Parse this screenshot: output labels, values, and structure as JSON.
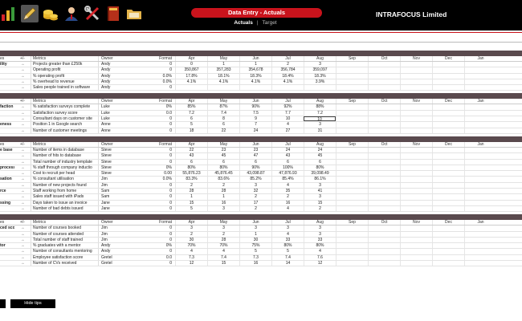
{
  "header": {
    "title": "Data Entry - Actuals",
    "tab_active": "Actuals",
    "tab_separator": "|",
    "tab_inactive": "Target",
    "company": "INTRAFOCUS Limited",
    "icons": [
      "bar-chart-icon",
      "pencil-icon",
      "coins-icon",
      "user-icon",
      "tools-icon",
      "book-icon",
      "folder-icon"
    ]
  },
  "columns": {
    "group": "es",
    "pm": "+/-",
    "metrics": "Metrics",
    "owner": "Owner",
    "format": "Format",
    "months": [
      "Apr",
      "May",
      "Jun",
      "Jul",
      "Aug",
      "Sep",
      "Oct",
      "Nov",
      "Dec",
      "Jan"
    ]
  },
  "sections": [
    {
      "header_group": "es",
      "rows": [
        {
          "group": "ility",
          "pm": "→",
          "metric": "Projects greater than £250k",
          "owner": "Andy",
          "format": "0",
          "values": [
            "0",
            "1",
            "1",
            "2",
            "3",
            "",
            "",
            "",
            "",
            ""
          ]
        },
        {
          "group": "",
          "pm": "→",
          "metric": "Operating profit",
          "owner": "Andy",
          "format": "0",
          "values": [
            "350,867",
            "357,283",
            "354,678",
            "356,784",
            "359,097",
            "",
            "",
            "",
            "",
            ""
          ]
        },
        {
          "group": "",
          "pm": "→",
          "metric": "% operating profit",
          "owner": "Andy",
          "format": "0.0%",
          "values": [
            "17.8%",
            "18.1%",
            "18.3%",
            "18.4%",
            "18.3%",
            "",
            "",
            "",
            "",
            ""
          ]
        },
        {
          "group": "",
          "pm": "→",
          "metric": "% overhead to revenue",
          "owner": "Andy",
          "format": "0.0%",
          "values": [
            "4.1%",
            "4.1%",
            "4.1%",
            "4.1%",
            "3.9%",
            "",
            "",
            "",
            "",
            ""
          ]
        },
        {
          "group": "",
          "pm": "→",
          "metric": "Sales people trained in software",
          "owner": "Andy",
          "format": "0",
          "values": [
            "",
            "",
            "",
            "",
            "",
            "",
            "",
            "",
            "",
            ""
          ]
        }
      ]
    },
    {
      "header_group": "",
      "rows": [
        {
          "group": "faction",
          "pm": "→",
          "metric": "% satisfaction surveys complete",
          "owner": "Luke",
          "format": "0%",
          "values": [
            "85%",
            "87%",
            "90%",
            "92%",
            "88%",
            "",
            "",
            "",
            "",
            ""
          ]
        },
        {
          "group": "",
          "pm": "→",
          "metric": "Satisfaction survey score",
          "owner": "Luke",
          "format": "0.0",
          "values": [
            "7.2",
            "7.4",
            "7.5",
            "7.7",
            "7.2",
            "",
            "",
            "",
            "",
            ""
          ]
        },
        {
          "group": "",
          "pm": "→",
          "metric": "Consultant days on customer site",
          "owner": "Luke",
          "format": "0",
          "values": [
            "6",
            "8",
            "9",
            "10",
            "10",
            "",
            "",
            "",
            "",
            ""
          ]
        },
        {
          "group": "eness",
          "pm": "→",
          "metric": "Position 1 in Google search",
          "owner": "Anne",
          "format": "0",
          "values": [
            "5",
            "6",
            "7",
            "4",
            "3",
            "",
            "",
            "",
            "",
            ""
          ]
        },
        {
          "group": "",
          "pm": "→",
          "metric": "Number of customer meetings",
          "owner": "Anne",
          "format": "0",
          "values": [
            "18",
            "22",
            "24",
            "27",
            "31",
            "",
            "",
            "",
            "",
            ""
          ]
        }
      ]
    },
    {
      "header_group": "es",
      "rows": [
        {
          "group": "e base",
          "pm": "→",
          "metric": "Number of items in database",
          "owner": "Steve",
          "format": "0",
          "values": [
            "22",
            "23",
            "23",
            "24",
            "24",
            "",
            "",
            "",
            "",
            ""
          ]
        },
        {
          "group": "",
          "pm": "→",
          "metric": "Number of hits to database",
          "owner": "Steve",
          "format": "0",
          "values": [
            "43",
            "45",
            "47",
            "43",
            "45",
            "",
            "",
            "",
            "",
            ""
          ]
        },
        {
          "group": "",
          "pm": "→",
          "metric": "Total number of industry template",
          "owner": "Steve",
          "format": "0",
          "values": [
            "6",
            "6",
            "6",
            "6",
            "6",
            "",
            "",
            "",
            "",
            ""
          ]
        },
        {
          "group": "process",
          "pm": "→",
          "metric": "% staff through company inductio",
          "owner": "Steve",
          "format": "0%",
          "values": [
            "80%",
            "80%",
            "90%",
            "100%",
            "80%",
            "",
            "",
            "",
            "",
            ""
          ]
        },
        {
          "group": "",
          "pm": "→",
          "metric": "Cost to recruit per head",
          "owner": "Steve",
          "format": "0.00",
          "values": [
            "55,876.23",
            "45,876.45",
            "43,098.87",
            "47,876.93",
            "39,098.49",
            "",
            "",
            "",
            "",
            ""
          ]
        },
        {
          "group": "sation",
          "pm": "→",
          "metric": "% consultant utilisation",
          "owner": "Jim",
          "format": "0.0%",
          "values": [
            "83.3%",
            "83.6%",
            "85.2%",
            "85.4%",
            "86.1%",
            "",
            "",
            "",
            "",
            ""
          ]
        },
        {
          "group": "",
          "pm": "→",
          "metric": "Number of new projects found",
          "owner": "Jim",
          "format": "0",
          "values": [
            "2",
            "2",
            "3",
            "4",
            "3",
            "",
            "",
            "",
            "",
            ""
          ]
        },
        {
          "group": "rce",
          "pm": "→",
          "metric": "Staff working from home",
          "owner": "Sam",
          "format": "0",
          "values": [
            "28",
            "28",
            "32",
            "35",
            "41",
            "",
            "",
            "",
            "",
            ""
          ]
        },
        {
          "group": "",
          "pm": "→",
          "metric": "Sales staff issued with iPads",
          "owner": "Sam",
          "format": "0",
          "values": [
            "1",
            "1",
            "2",
            "2",
            "3",
            "",
            "",
            "",
            "",
            ""
          ]
        },
        {
          "group": "ssing",
          "pm": "→",
          "metric": "Days taken to issue an invoice",
          "owner": "Jane",
          "format": "0",
          "values": [
            "15",
            "16",
            "17",
            "16",
            "15",
            "",
            "",
            "",
            "",
            ""
          ]
        },
        {
          "group": "",
          "pm": "→",
          "metric": "Number of bad debts issued",
          "owner": "Jane",
          "format": "0",
          "values": [
            "5",
            "3",
            "2",
            "4",
            "2",
            "",
            "",
            "",
            "",
            ""
          ]
        }
      ]
    },
    {
      "header_group": "es",
      "rows": [
        {
          "group": "ced score",
          "pm": "→",
          "metric": "Number of courses booked",
          "owner": "Jim",
          "format": "0",
          "values": [
            "3",
            "3",
            "3",
            "3",
            "3",
            "",
            "",
            "",
            "",
            ""
          ]
        },
        {
          "group": "",
          "pm": "→",
          "metric": "Number of courses attended",
          "owner": "Jim",
          "format": "0",
          "values": [
            "2",
            "2",
            "1",
            "4",
            "3",
            "",
            "",
            "",
            "",
            ""
          ]
        },
        {
          "group": "",
          "pm": "→",
          "metric": "Total number of staff trained",
          "owner": "Jim",
          "format": "0",
          "values": [
            "30",
            "28",
            "30",
            "33",
            "33",
            "",
            "",
            "",
            "",
            ""
          ]
        },
        {
          "group": "tor",
          "pm": "→",
          "metric": "% graduates with a mentor",
          "owner": "Andy",
          "format": "0%",
          "values": [
            "70%",
            "70%",
            "75%",
            "80%",
            "80%",
            "",
            "",
            "",
            "",
            ""
          ]
        },
        {
          "group": "",
          "pm": "→",
          "metric": "Number of consultants mentoring",
          "owner": "Andy",
          "format": "0",
          "values": [
            "4",
            "4",
            "5",
            "5",
            "4",
            "",
            "",
            "",
            "",
            ""
          ]
        },
        {
          "group": "",
          "pm": "→",
          "metric": "Employee satisfaction score",
          "owner": "Gretel",
          "format": "0.0",
          "values": [
            "7.3",
            "7.4",
            "7.3",
            "7.4",
            "7.6",
            "",
            "",
            "",
            "",
            ""
          ]
        },
        {
          "group": "",
          "pm": "→",
          "metric": "Number of CVs received",
          "owner": "Gretel",
          "format": "0",
          "values": [
            "12",
            "15",
            "16",
            "14",
            "12",
            "",
            "",
            "",
            "",
            ""
          ]
        }
      ]
    }
  ],
  "footer": {
    "hide_tips": "Hide tips"
  }
}
